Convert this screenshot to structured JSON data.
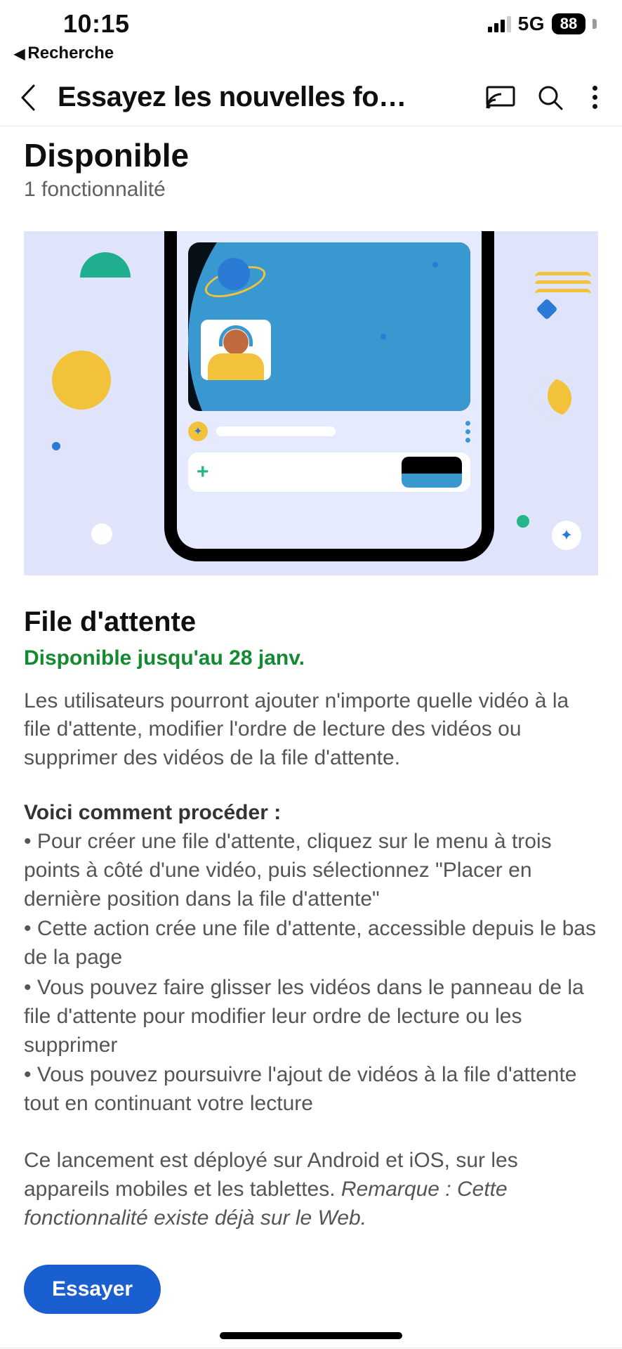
{
  "status": {
    "time": "10:15",
    "network": "5G",
    "battery": "88"
  },
  "back_to": {
    "label": "Recherche"
  },
  "header": {
    "title": "Essayez les nouvelles fo…"
  },
  "section": {
    "title": "Disponible",
    "subtitle": "1 fonctionnalité"
  },
  "feature": {
    "title": "File d'attente",
    "availability": "Disponible jusqu'au 28 janv.",
    "description": "Les utilisateurs pourront ajouter n'importe quelle vidéo à la file d'attente, modifier l'ordre de lecture des vidéos ou supprimer des vidéos de la file d'attente.",
    "howto_title": "Voici comment procéder :",
    "howto": [
      "Pour créer une file d'attente, cliquez sur le menu à trois points à côté d'une vidéo, puis sélectionnez \"Placer en dernière position dans la file d'attente\"",
      "Cette action crée une file d'attente, accessible depuis le bas de la page",
      "Vous pouvez faire glisser les vidéos dans le panneau de la file d'attente pour modifier leur ordre de lecture ou les supprimer",
      "Vous pouvez poursuivre l'ajout de vidéos à la file d'attente tout en continuant votre lecture"
    ],
    "footnote_plain": "Ce lancement est déployé sur Android et iOS, sur les appareils mobiles et les tablettes. ",
    "footnote_em": "Remarque : Cette fonctionnalité existe déjà sur le Web.",
    "cta": "Essayer"
  }
}
